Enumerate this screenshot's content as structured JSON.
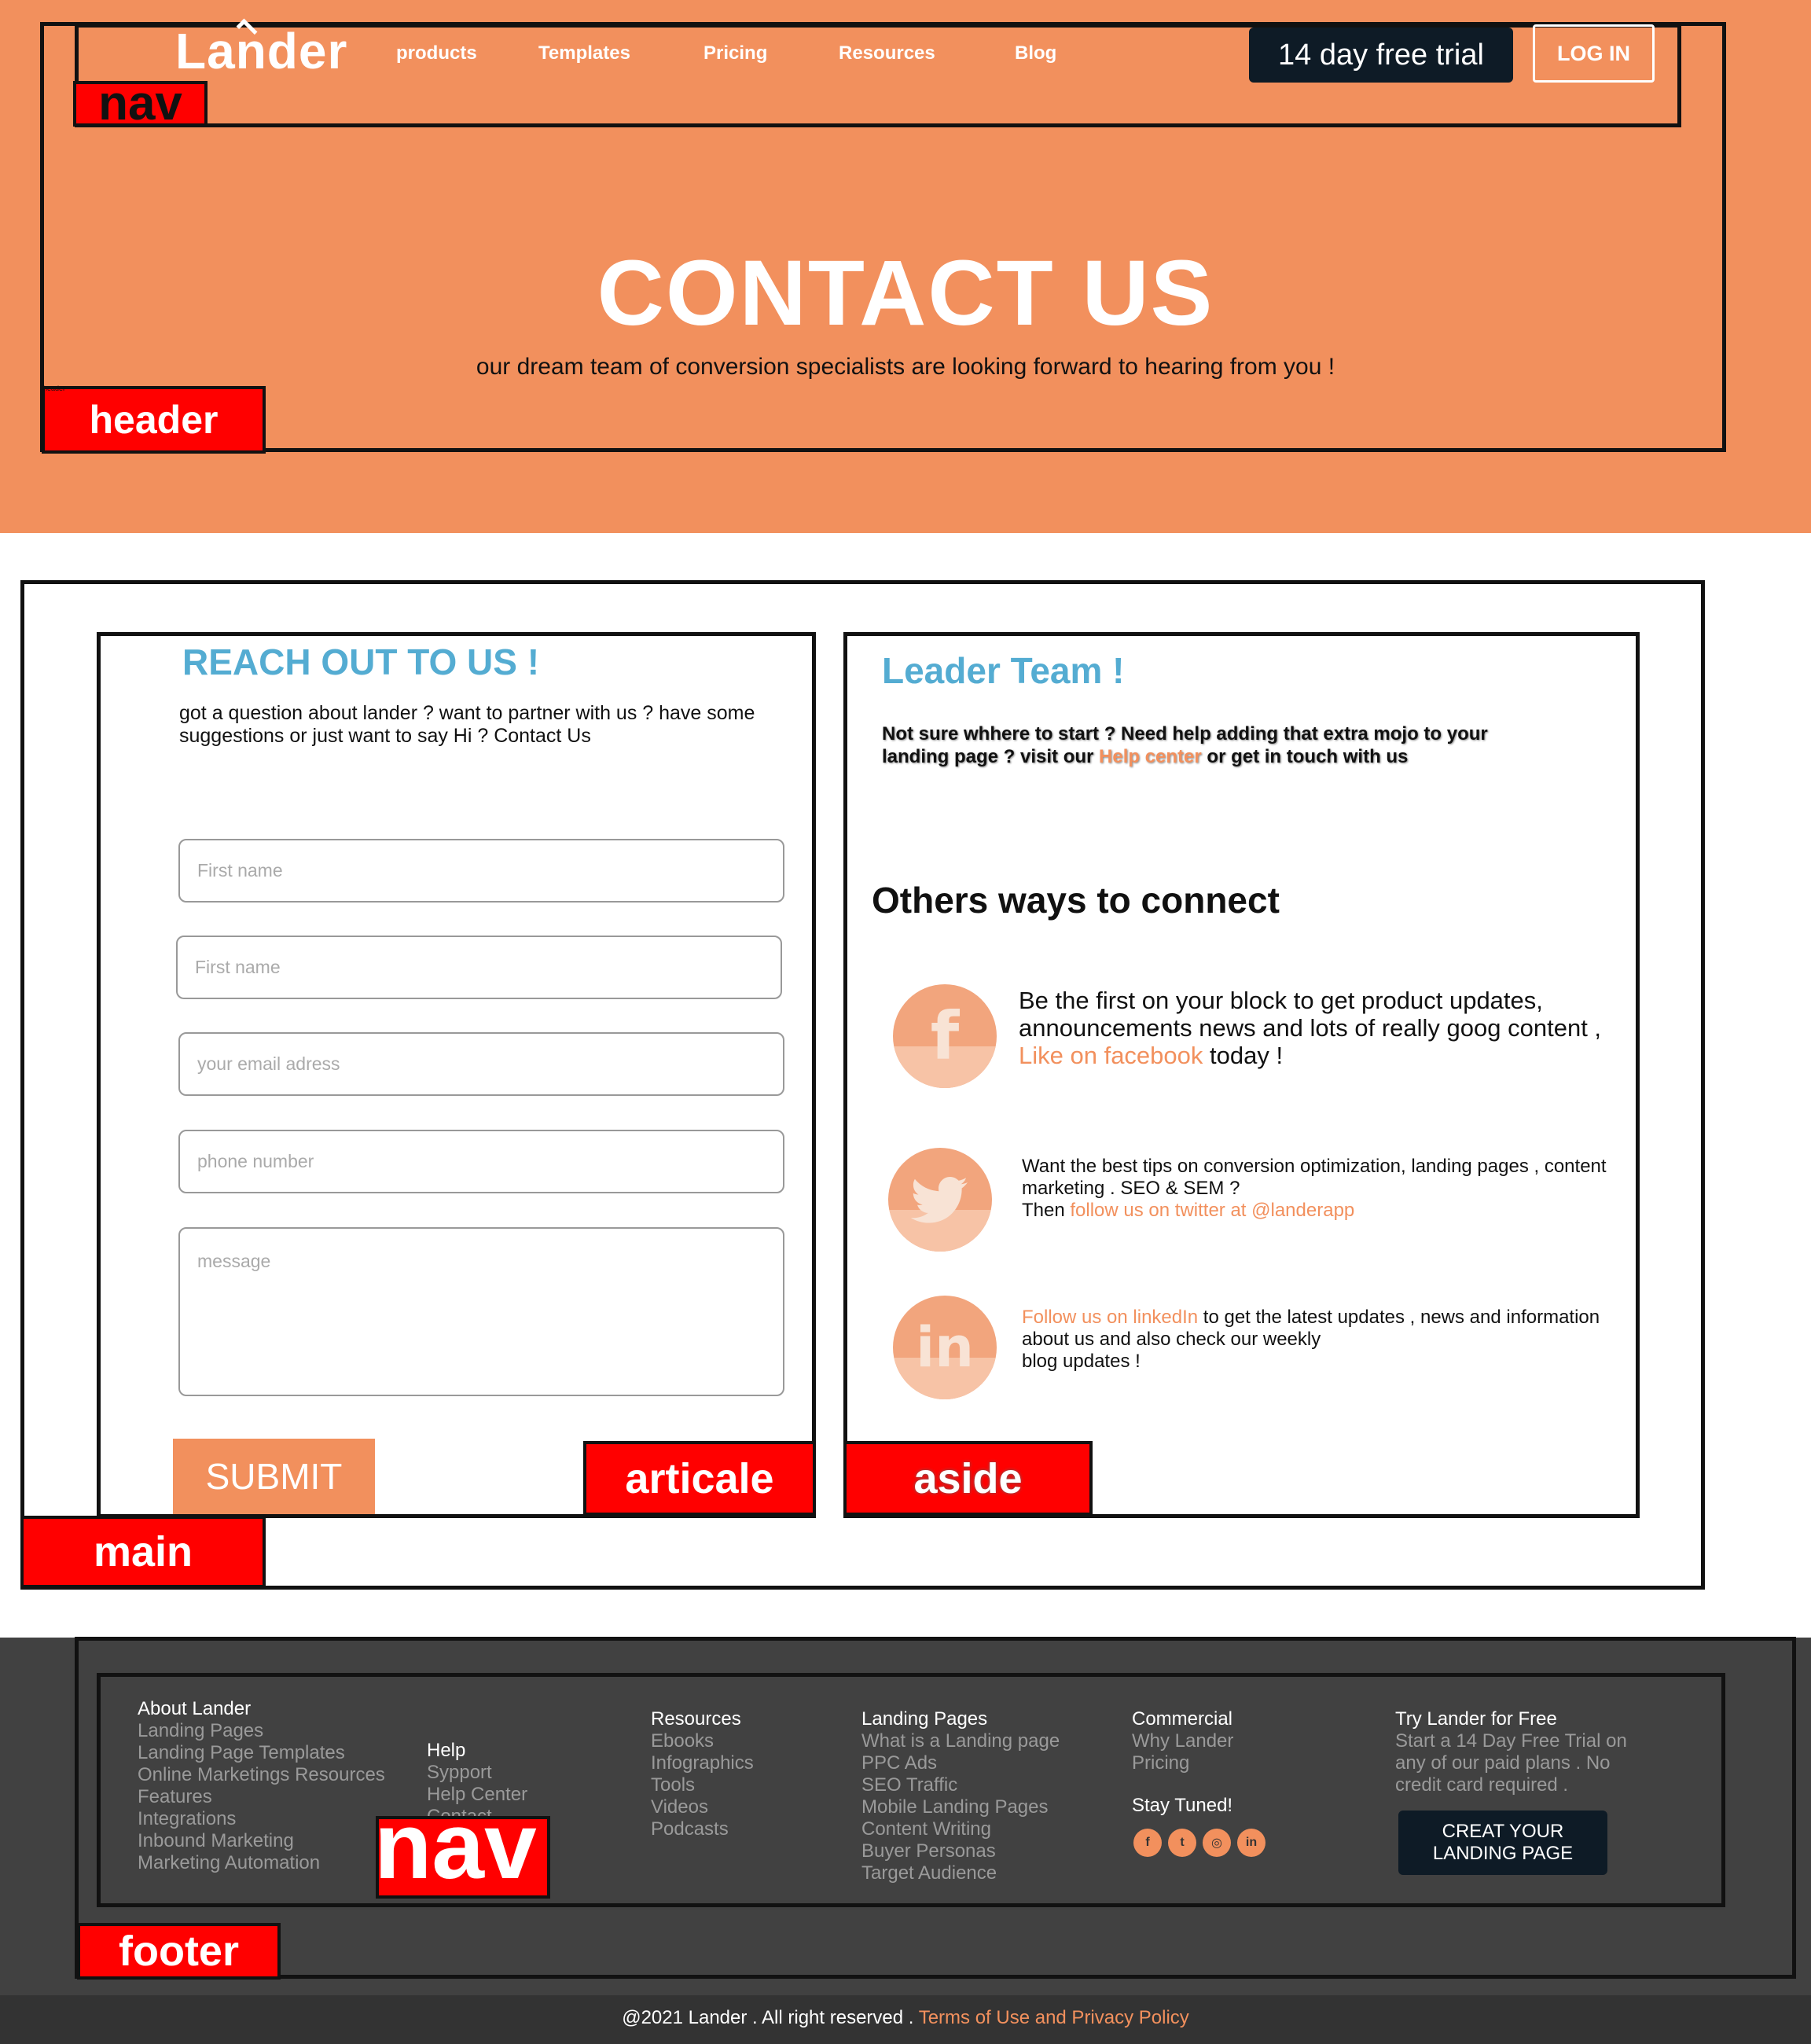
{
  "header": {
    "logo": "Lander",
    "nav": [
      "products",
      "Templates",
      "Pricing",
      "Resources",
      "Blog"
    ],
    "trial_button": "14 day free trial",
    "login_button": "LOG IN",
    "title": "CONTACT US",
    "subtitle": "our dream team of conversion specialists are looking forward to hearing from you !",
    "annotations": {
      "nav": "nav",
      "header": "header",
      "header_small": "header"
    }
  },
  "article": {
    "title": "REACH OUT TO US !",
    "text": "got a question about lander ? want to partner with us ? have some suggestions or just want to say Hi ? Contact Us",
    "fields": {
      "first_name": "First name",
      "second_name": "First name",
      "email": "your email adress",
      "phone": "phone number",
      "message": "message"
    },
    "submit": "SUBMIT",
    "annotation": "articale"
  },
  "aside": {
    "title": "Leader Team !",
    "text_before": "Not sure whhere to start ? Need help adding that extra mojo to your landing page ? visit our ",
    "help_link": "Help center",
    "text_after": " or get in touch with us",
    "others_title": "Others ways to connect",
    "facebook": {
      "text": "Be the first on your block to get product updates, announcements news and lots of really goog content , ",
      "link": "Like on facebook",
      "after": " today !",
      "icon": "facebook-icon",
      "glyph": "f"
    },
    "twitter": {
      "text": "Want the best tips on conversion optimization, landing pages , content marketing . SEO & SEM ?",
      "then": "Then ",
      "link": "follow us on twitter at @landerapp",
      "icon": "twitter-icon",
      "glyph": "🐦"
    },
    "linkedin": {
      "link": "Follow us on linkedIn",
      "text": " to get the latest updates , news and information about us and also check our weekly",
      "text2": " blog updates !",
      "icon": "linkedin-icon",
      "glyph": "in"
    },
    "annotation": "aside"
  },
  "main": {
    "annotation": "main"
  },
  "footer": {
    "col1": {
      "head": "About Lander",
      "links": [
        "Landing Pages",
        "Landing Page Templates",
        "Online Marketings Resources",
        "Features",
        "Integrations",
        "Inbound Marketing",
        "Marketing Automation"
      ]
    },
    "col2": {
      "head": "Help",
      "links": [
        "Sypport",
        "Help Center",
        "Contact"
      ]
    },
    "col3": {
      "head": "Resources",
      "links": [
        "Ebooks",
        "Infographics",
        "Tools",
        "Videos",
        "Podcasts"
      ]
    },
    "col4": {
      "head": "Landing Pages",
      "links": [
        "What is a Landing page",
        "PPC Ads",
        "SEO Traffic",
        "Mobile Landing Pages",
        "Content Writing",
        "Buyer Personas",
        "Target Audience"
      ]
    },
    "col5": {
      "head": "Commercial",
      "links": [
        "Why Lander",
        "Pricing"
      ]
    },
    "stay_tuned": "Stay Tuned!",
    "social": [
      {
        "icon": "facebook-icon",
        "glyph": "f"
      },
      {
        "icon": "twitter-icon",
        "glyph": "t"
      },
      {
        "icon": "instagram-icon",
        "glyph": "◎"
      },
      {
        "icon": "linkedin-icon",
        "glyph": "in"
      }
    ],
    "col6": {
      "head": "Try Lander for Free",
      "text": "Start a 14 Day Free Trial on any of our paid plans . No credit card required ."
    },
    "create_button": "CREAT YOUR LANDING PAGE",
    "annotations": {
      "footer": "footer",
      "nav": "nav"
    },
    "copyright": "@2021 Lander . All right reserved . ",
    "terms": "Terms of Use and Privacy Policy"
  },
  "colors": {
    "orange": "#f2905d",
    "blue": "#54acd2",
    "dark": "#0e1b26",
    "footer": "#414141",
    "annotation_red": "#ff0000"
  }
}
